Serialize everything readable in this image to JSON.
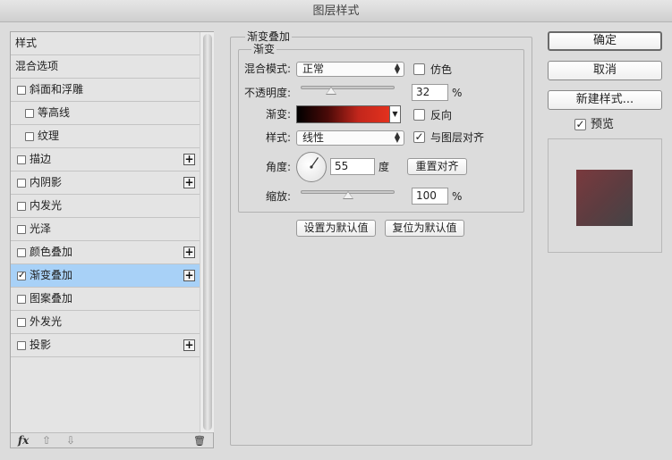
{
  "window": {
    "title": "图层样式"
  },
  "style_list": {
    "header_items": [
      {
        "label": "样式"
      },
      {
        "label": "混合选项"
      }
    ],
    "items": [
      {
        "label": "斜面和浮雕",
        "checked": false,
        "indent": false,
        "has_add": false
      },
      {
        "label": "等高线",
        "checked": false,
        "indent": true,
        "has_add": false
      },
      {
        "label": "纹理",
        "checked": false,
        "indent": true,
        "has_add": false
      },
      {
        "label": "描边",
        "checked": false,
        "indent": false,
        "has_add": true
      },
      {
        "label": "内阴影",
        "checked": false,
        "indent": false,
        "has_add": true
      },
      {
        "label": "内发光",
        "checked": false,
        "indent": false,
        "has_add": false
      },
      {
        "label": "光泽",
        "checked": false,
        "indent": false,
        "has_add": false
      },
      {
        "label": "颜色叠加",
        "checked": false,
        "indent": false,
        "has_add": true
      },
      {
        "label": "渐变叠加",
        "checked": true,
        "indent": false,
        "has_add": true,
        "selected": true
      },
      {
        "label": "图案叠加",
        "checked": false,
        "indent": false,
        "has_add": false
      },
      {
        "label": "外发光",
        "checked": false,
        "indent": false,
        "has_add": false
      },
      {
        "label": "投影",
        "checked": false,
        "indent": false,
        "has_add": true
      }
    ],
    "checkmark": "✓",
    "plus_symbol": "+",
    "footer": {
      "fx_label": "fx",
      "up_arrow": "⇧",
      "down_arrow": "⇩",
      "trash": "🗑"
    }
  },
  "gradient_overlay": {
    "section_title": "渐变叠加",
    "subsection_title": "渐变",
    "blend_mode_label": "混合模式:",
    "blend_mode_value": "正常",
    "dither_label": "仿色",
    "dither_checked": false,
    "opacity_label": "不透明度:",
    "opacity_value": "32",
    "opacity_fraction": 0.32,
    "percent_unit": "%",
    "gradient_label": "渐变:",
    "gradient_colors": [
      "#000000",
      "#4a0a08",
      "#c2261c",
      "#e3321e"
    ],
    "reverse_label": "反向",
    "reverse_checked": false,
    "style_label": "样式:",
    "style_value": "线性",
    "align_label": "与图层对齐",
    "align_checked": true,
    "angle_label": "角度:",
    "angle_value": "55",
    "angle_unit": "度",
    "reset_align_label": "重置对齐",
    "scale_label": "缩放:",
    "scale_value": "100",
    "scale_fraction": 0.5,
    "set_default_label": "设置为默认值",
    "reset_default_label": "复位为默认值"
  },
  "actions": {
    "ok_label": "确定",
    "cancel_label": "取消",
    "new_style_label": "新建样式...",
    "preview_label": "预览",
    "preview_checked": true
  }
}
